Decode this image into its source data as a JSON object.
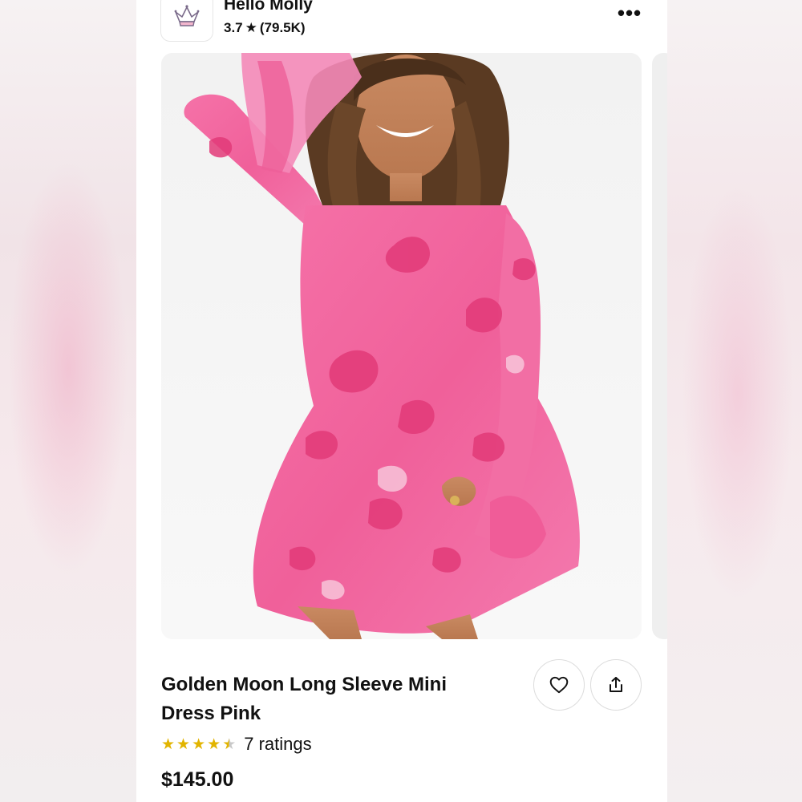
{
  "shop": {
    "name": "Hello Molly",
    "rating": "3.7",
    "review_count": "(79.5K)",
    "logo_icon": "crown-icon"
  },
  "header": {
    "more_icon": "more-icon",
    "more_label": "•••"
  },
  "product": {
    "title": "Golden Moon Long Sleeve Mini Dress Pink",
    "image_description_icon": "product-photo",
    "rating_value": 4.5,
    "ratings_text": "7 ratings",
    "price": "$145.00"
  },
  "actions": {
    "favorite_icon": "heart-icon",
    "share_icon": "share-icon"
  },
  "colors": {
    "dress_pink": "#f0609a",
    "floral_pink": "#e23a78",
    "star_gold": "#e2b400",
    "text": "#111111"
  }
}
